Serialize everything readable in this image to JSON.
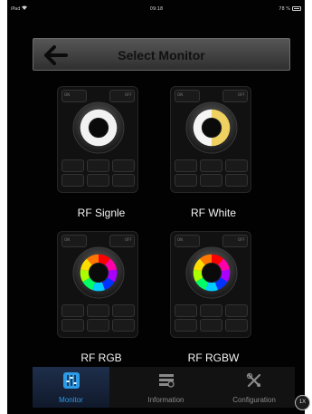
{
  "status_bar": {
    "device": "iPad",
    "time": "09:18",
    "battery": "78 %"
  },
  "header": {
    "title": "Select Monitor"
  },
  "monitors": [
    {
      "label": "RF Signle",
      "wheel": "white"
    },
    {
      "label": "RF White",
      "wheel": "white-warm"
    },
    {
      "label": "RF RGB",
      "wheel": "rgb"
    },
    {
      "label": "RF RGBW",
      "wheel": "rgbw"
    }
  ],
  "remote": {
    "on_label": "ON",
    "off_label": "OFF"
  },
  "tabs": [
    {
      "label": "Monitor",
      "icon": "sliders-icon",
      "active": true
    },
    {
      "label": "Information",
      "icon": "info-icon",
      "active": false
    },
    {
      "label": "Configuration",
      "icon": "tools-icon",
      "active": false
    }
  ],
  "zoom_badge": "1X",
  "colors": {
    "accent": "#2c9be8",
    "background": "#020202",
    "header": "#454545"
  }
}
